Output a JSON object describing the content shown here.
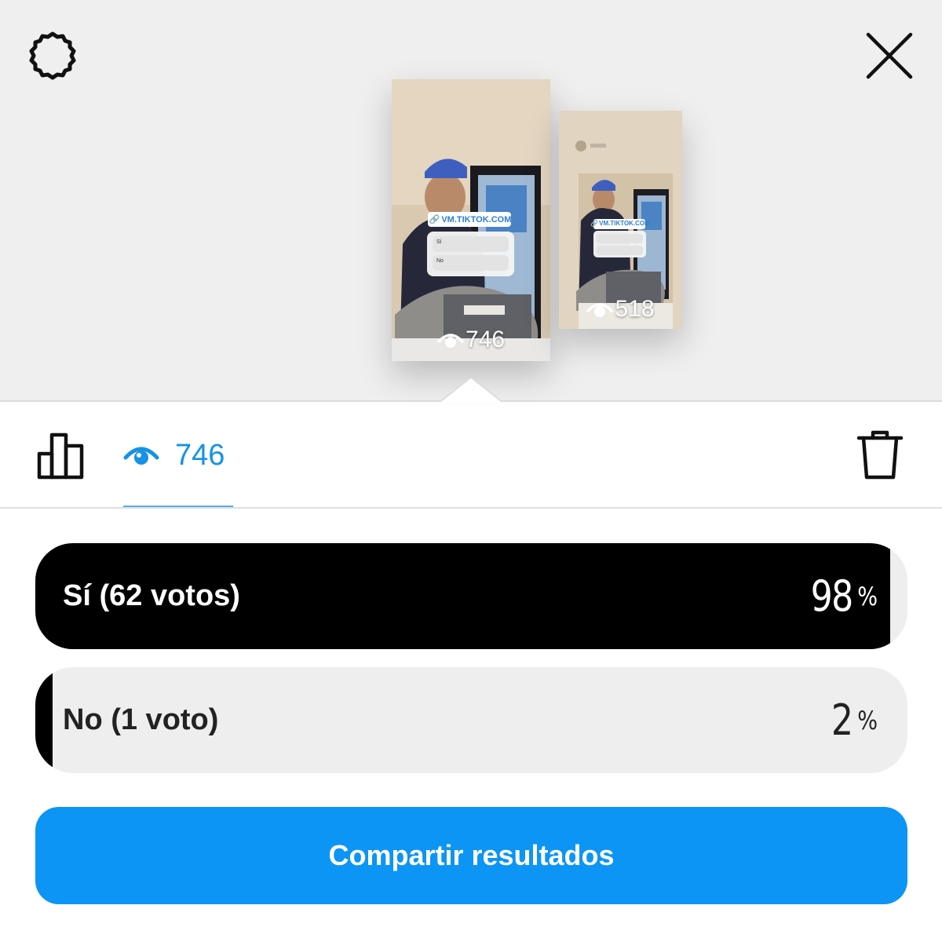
{
  "stories": [
    {
      "views": "746",
      "link_sticker": "VM.TIKTOK.COM",
      "poll_options": [
        "Sí",
        "No"
      ]
    },
    {
      "views": "518",
      "link_sticker": "VM.TIKTOK.COM"
    }
  ],
  "tabs": {
    "viewers_count": "746"
  },
  "poll": {
    "options": [
      {
        "label": "Sí (62 votos)",
        "percent": "98",
        "percent_value": 98
      },
      {
        "label": "No (1 voto)",
        "percent": "2",
        "percent_value": 2
      }
    ],
    "percent_sign": "%"
  },
  "share_button": {
    "label": "Compartir resultados"
  },
  "colors": {
    "accent": "#0c95f5",
    "tab_active": "#1592e6",
    "bar_fill": "#000000",
    "bar_track": "#eeeeee"
  },
  "icons": [
    "settings-icon",
    "close-icon",
    "eye-icon",
    "bar-chart-icon",
    "trash-icon",
    "link-icon"
  ]
}
